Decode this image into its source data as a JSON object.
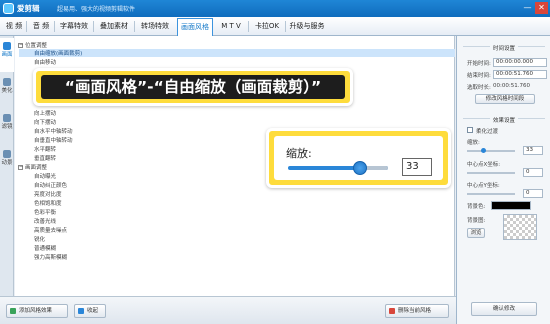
{
  "app": {
    "name": "爱剪辑",
    "slogan": "超易用、强大的视频剪辑软件"
  },
  "window": {
    "minimize": "—",
    "close": "✕"
  },
  "menu": [
    "视 频",
    "音 频",
    "字幕特效",
    "叠加素材",
    "转场特效",
    "画面风格",
    "M T V",
    "卡拉OK",
    "升级与服务"
  ],
  "sidebar": [
    {
      "label": "画面",
      "icon": "image-icon"
    },
    {
      "label": "美化",
      "icon": "brush-icon"
    },
    {
      "label": "滤镜",
      "icon": "filter-icon"
    },
    {
      "label": "动景",
      "icon": "motion-icon"
    }
  ],
  "list": {
    "group1": "位置调整",
    "items1a": [
      "自由缩放(画面裁剪)",
      "自由移动"
    ],
    "items1b": [
      "向上摆动",
      "向下摆动",
      "自水平中轴转动",
      "自垂直中轴转动",
      "水平翻转",
      "垂直翻转"
    ],
    "group2": "画面调整",
    "items2": [
      "自动曝光",
      "自动纠正颜色",
      "亮度对比度",
      "色相饱和度",
      "色彩平衡",
      "改善光线",
      "高质量去噪点",
      "锐化",
      "普通模糊",
      "强力高斯模糊"
    ]
  },
  "callout": {
    "text": "“画面风格”-“自由缩放（画面裁剪）”"
  },
  "zoom": {
    "label": "缩放:",
    "value": "33",
    "level": 0.33
  },
  "bottom": {
    "add": "添加风格效果",
    "collapse": "收起",
    "delete": "删除当前风格"
  },
  "time_settings": {
    "title": "时间设置",
    "start_label": "开始时间:",
    "start": "00:00:00.000",
    "end_label": "结束时间:",
    "end": "00:00:51.760",
    "duration_label": "选取时长:",
    "duration": "00:00:51.760",
    "modify_button": "修改风格时间段"
  },
  "effect_settings": {
    "title": "效果设置",
    "soft_label": "柔化过渡",
    "zoom_label": "缩放:",
    "zoom_value": "33",
    "cx_label": "中心点X坐标:",
    "cx_value": "0",
    "cy_label": "中心点Y坐标:",
    "cy_value": "0",
    "bgcolor_label": "背景色:",
    "bgimage_label": "背景图:",
    "browse": "浏览"
  },
  "confirm": "确认修改",
  "colors": {
    "accent": "#2a86d8",
    "callout": "#fedc3c",
    "selected_row": "#cce4fb"
  }
}
